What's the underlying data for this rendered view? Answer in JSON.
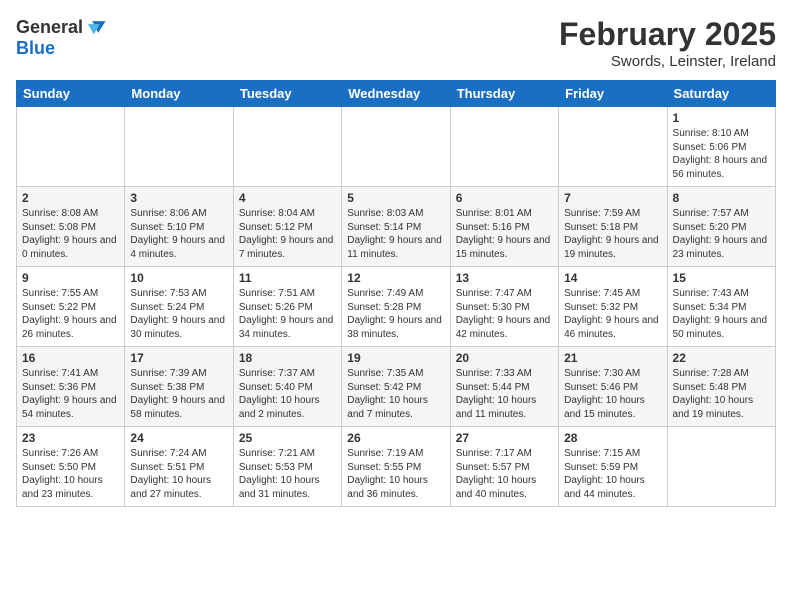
{
  "logo": {
    "general": "General",
    "blue": "Blue"
  },
  "title": "February 2025",
  "subtitle": "Swords, Leinster, Ireland",
  "days_of_week": [
    "Sunday",
    "Monday",
    "Tuesday",
    "Wednesday",
    "Thursday",
    "Friday",
    "Saturday"
  ],
  "weeks": [
    [
      {
        "day": "",
        "info": ""
      },
      {
        "day": "",
        "info": ""
      },
      {
        "day": "",
        "info": ""
      },
      {
        "day": "",
        "info": ""
      },
      {
        "day": "",
        "info": ""
      },
      {
        "day": "",
        "info": ""
      },
      {
        "day": "1",
        "info": "Sunrise: 8:10 AM\nSunset: 5:06 PM\nDaylight: 8 hours and 56 minutes."
      }
    ],
    [
      {
        "day": "2",
        "info": "Sunrise: 8:08 AM\nSunset: 5:08 PM\nDaylight: 9 hours and 0 minutes."
      },
      {
        "day": "3",
        "info": "Sunrise: 8:06 AM\nSunset: 5:10 PM\nDaylight: 9 hours and 4 minutes."
      },
      {
        "day": "4",
        "info": "Sunrise: 8:04 AM\nSunset: 5:12 PM\nDaylight: 9 hours and 7 minutes."
      },
      {
        "day": "5",
        "info": "Sunrise: 8:03 AM\nSunset: 5:14 PM\nDaylight: 9 hours and 11 minutes."
      },
      {
        "day": "6",
        "info": "Sunrise: 8:01 AM\nSunset: 5:16 PM\nDaylight: 9 hours and 15 minutes."
      },
      {
        "day": "7",
        "info": "Sunrise: 7:59 AM\nSunset: 5:18 PM\nDaylight: 9 hours and 19 minutes."
      },
      {
        "day": "8",
        "info": "Sunrise: 7:57 AM\nSunset: 5:20 PM\nDaylight: 9 hours and 23 minutes."
      }
    ],
    [
      {
        "day": "9",
        "info": "Sunrise: 7:55 AM\nSunset: 5:22 PM\nDaylight: 9 hours and 26 minutes."
      },
      {
        "day": "10",
        "info": "Sunrise: 7:53 AM\nSunset: 5:24 PM\nDaylight: 9 hours and 30 minutes."
      },
      {
        "day": "11",
        "info": "Sunrise: 7:51 AM\nSunset: 5:26 PM\nDaylight: 9 hours and 34 minutes."
      },
      {
        "day": "12",
        "info": "Sunrise: 7:49 AM\nSunset: 5:28 PM\nDaylight: 9 hours and 38 minutes."
      },
      {
        "day": "13",
        "info": "Sunrise: 7:47 AM\nSunset: 5:30 PM\nDaylight: 9 hours and 42 minutes."
      },
      {
        "day": "14",
        "info": "Sunrise: 7:45 AM\nSunset: 5:32 PM\nDaylight: 9 hours and 46 minutes."
      },
      {
        "day": "15",
        "info": "Sunrise: 7:43 AM\nSunset: 5:34 PM\nDaylight: 9 hours and 50 minutes."
      }
    ],
    [
      {
        "day": "16",
        "info": "Sunrise: 7:41 AM\nSunset: 5:36 PM\nDaylight: 9 hours and 54 minutes."
      },
      {
        "day": "17",
        "info": "Sunrise: 7:39 AM\nSunset: 5:38 PM\nDaylight: 9 hours and 58 minutes."
      },
      {
        "day": "18",
        "info": "Sunrise: 7:37 AM\nSunset: 5:40 PM\nDaylight: 10 hours and 2 minutes."
      },
      {
        "day": "19",
        "info": "Sunrise: 7:35 AM\nSunset: 5:42 PM\nDaylight: 10 hours and 7 minutes."
      },
      {
        "day": "20",
        "info": "Sunrise: 7:33 AM\nSunset: 5:44 PM\nDaylight: 10 hours and 11 minutes."
      },
      {
        "day": "21",
        "info": "Sunrise: 7:30 AM\nSunset: 5:46 PM\nDaylight: 10 hours and 15 minutes."
      },
      {
        "day": "22",
        "info": "Sunrise: 7:28 AM\nSunset: 5:48 PM\nDaylight: 10 hours and 19 minutes."
      }
    ],
    [
      {
        "day": "23",
        "info": "Sunrise: 7:26 AM\nSunset: 5:50 PM\nDaylight: 10 hours and 23 minutes."
      },
      {
        "day": "24",
        "info": "Sunrise: 7:24 AM\nSunset: 5:51 PM\nDaylight: 10 hours and 27 minutes."
      },
      {
        "day": "25",
        "info": "Sunrise: 7:21 AM\nSunset: 5:53 PM\nDaylight: 10 hours and 31 minutes."
      },
      {
        "day": "26",
        "info": "Sunrise: 7:19 AM\nSunset: 5:55 PM\nDaylight: 10 hours and 36 minutes."
      },
      {
        "day": "27",
        "info": "Sunrise: 7:17 AM\nSunset: 5:57 PM\nDaylight: 10 hours and 40 minutes."
      },
      {
        "day": "28",
        "info": "Sunrise: 7:15 AM\nSunset: 5:59 PM\nDaylight: 10 hours and 44 minutes."
      },
      {
        "day": "",
        "info": ""
      }
    ]
  ]
}
